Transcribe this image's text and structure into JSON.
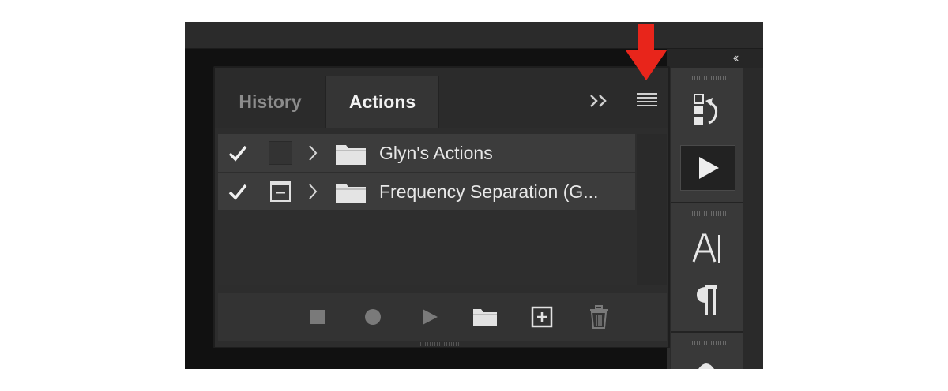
{
  "panel": {
    "tabs": [
      {
        "label": "History",
        "active": false
      },
      {
        "label": "Actions",
        "active": true
      }
    ],
    "expand_icon": "double-chevron-right-icon",
    "menu_icon": "hamburger-menu-icon"
  },
  "actions": {
    "rows": [
      {
        "label": "Glyn's Actions",
        "checked": true,
        "dialog": "none"
      },
      {
        "label": "Frequency Separation (G...",
        "checked": true,
        "dialog": "partial"
      }
    ]
  },
  "footer": {
    "buttons": [
      "stop-icon",
      "record-icon",
      "play-icon",
      "folder-icon",
      "new-action-icon",
      "trash-icon"
    ]
  },
  "dock": {
    "collapse_label": "‹‹",
    "buttons": [
      "history-icon",
      "actions-play-icon",
      "character-icon",
      "paragraph-icon"
    ]
  },
  "annotation": {
    "color": "#e8251b",
    "icon": "red-arrow-down-icon"
  },
  "colors": {
    "panel_bg": "#2d2d2d",
    "row_bg": "#3c3c3c",
    "text": "#e8e8e8"
  }
}
